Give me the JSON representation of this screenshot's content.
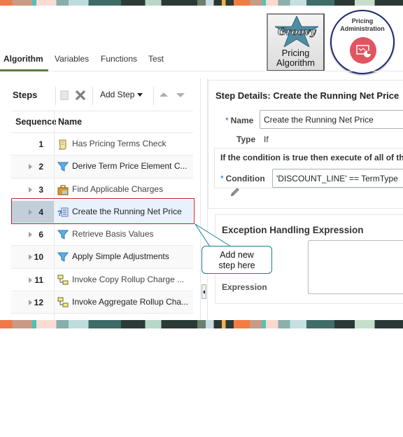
{
  "header": {
    "tabs": [
      {
        "label": "Algorithm",
        "active": true
      },
      {
        "label": "Variables",
        "active": false
      },
      {
        "label": "Functions",
        "active": false
      },
      {
        "label": "Test",
        "active": false
      }
    ],
    "logos": {
      "groovy_card_label_line1": "Pricing",
      "groovy_card_label_line2": "Algorithm",
      "groovy_wordmark": "Groovy",
      "admin_label_line1": "Pricing",
      "admin_label_line2": "Administration",
      "admin_accent": "#e05561"
    }
  },
  "steps": {
    "title": "Steps",
    "toolbar": {
      "add_step_label": "Add Step"
    },
    "columns": {
      "sequence": "Sequence",
      "name": "Name"
    },
    "rows": [
      {
        "seq": "1",
        "name": "Has Pricing Terms Check",
        "icon": "script-icon",
        "expandable": false,
        "selected": false
      },
      {
        "seq": "2",
        "name": "Derive Term Price Element C...",
        "icon": "filter-icon",
        "expandable": true,
        "selected": false
      },
      {
        "seq": "3",
        "name": "Find Applicable Charges",
        "icon": "briefcase-icon",
        "expandable": true,
        "selected": false
      },
      {
        "seq": "4",
        "name": "Create the Running Net Price",
        "icon": "conditional-icon",
        "expandable": true,
        "selected": true
      },
      {
        "seq": "6",
        "name": "Retrieve Basis Values",
        "icon": "filter-icon",
        "expandable": true,
        "selected": false
      },
      {
        "seq": "10",
        "name": "Apply Simple Adjustments",
        "icon": "filter-icon",
        "expandable": true,
        "selected": false
      },
      {
        "seq": "11",
        "name": "Invoke Copy Rollup Charge ...",
        "icon": "invoke-icon",
        "expandable": true,
        "selected": false
      },
      {
        "seq": "12",
        "name": "Invoke Aggregate Rollup Cha...",
        "icon": "invoke-icon",
        "expandable": true,
        "selected": false
      }
    ]
  },
  "details": {
    "title": "Step Details: Create the Running Net Price",
    "name_label": "Name",
    "name_value": "Create the Running Net Price",
    "type_label": "Type",
    "type_value": "If",
    "condition_intro": "If the condition is true then execute of all of the",
    "condition_label": "Condition",
    "condition_value": "'DISCOUNT_LINE' == TermType"
  },
  "exception": {
    "title": "Exception Handling Expression",
    "expression_label": "Expression",
    "expression_value": ""
  },
  "callout": {
    "line1": "Add new",
    "line2": "step here",
    "border_color": "#1c7f8d"
  },
  "highlight_color": "#c4242c"
}
